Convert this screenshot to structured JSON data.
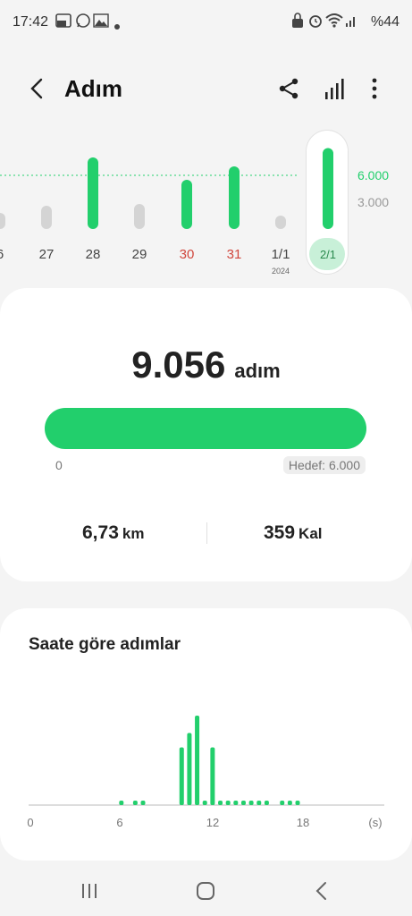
{
  "status_bar": {
    "time": "17:42",
    "battery": "%44",
    "icons": [
      "gallery-05-icon",
      "whatsapp-icon",
      "photo-icon",
      "dot-icon",
      "lock-icon",
      "alarm-icon",
      "wifi-icon",
      "signal-icon"
    ]
  },
  "header": {
    "title": "Adım",
    "icons": [
      "back-icon",
      "share-icon",
      "bar-chart-icon",
      "more-icon"
    ]
  },
  "daily_chart": {
    "days": [
      {
        "label": "6",
        "value": 1800,
        "color": "#d4d4d4",
        "weekend": false
      },
      {
        "label": "27",
        "value": 2600,
        "color": "#d4d4d4",
        "weekend": false
      },
      {
        "label": "28",
        "value": 8000,
        "color": "#22cf6c",
        "weekend": false
      },
      {
        "label": "29",
        "value": 2800,
        "color": "#d4d4d4",
        "weekend": false
      },
      {
        "label": "30",
        "value": 5500,
        "color": "#22cf6c",
        "weekend": true
      },
      {
        "label": "31",
        "value": 7000,
        "color": "#22cf6c",
        "weekend": true
      },
      {
        "label": "1/1",
        "sublabel": "2024",
        "value": 1500,
        "color": "#d4d4d4",
        "weekend": false
      },
      {
        "label": "2/1",
        "value": 9056,
        "color": "#22cf6c",
        "weekend": false,
        "selected": true
      }
    ],
    "goal_ticks": [
      {
        "label": "6.000",
        "value": 6000,
        "color": "#22cf6c"
      },
      {
        "label": "3.000",
        "value": 3000,
        "color": "#999999"
      }
    ]
  },
  "summary": {
    "steps": "9.056",
    "unit": "adım",
    "progress": 1.0,
    "min_label": "0",
    "goal_label": "Hedef: 6.000",
    "distance": "6,73",
    "distance_unit": "km",
    "calories": "359",
    "calories_unit": "Kal"
  },
  "hourly": {
    "title": "Saate göre adımlar",
    "x_ticks": [
      "0",
      "6",
      "12",
      "18",
      "(s)"
    ]
  },
  "chart_data": {
    "type": "bar",
    "title": "Saate göre adımlar",
    "xlabel": "(s)",
    "ylabel": "",
    "xlim": [
      0,
      21
    ],
    "x_ticks": [
      0,
      6,
      12,
      18
    ],
    "ylim": [
      0,
      1600
    ],
    "x": [
      6.0,
      6.9,
      7.4,
      9.9,
      10.4,
      10.9,
      11.4,
      11.9,
      12.4,
      12.9,
      13.4,
      13.9,
      14.4,
      14.9,
      15.4,
      16.4,
      16.9,
      17.4
    ],
    "values": [
      40,
      40,
      40,
      1000,
      1250,
      1550,
      40,
      1000,
      40,
      40,
      40,
      40,
      40,
      40,
      40,
      40,
      40,
      40
    ],
    "color": "#22cf6c"
  },
  "colors": {
    "accent": "#22cf6c",
    "weekend": "#d0463c",
    "inactive": "#d4d4d4"
  }
}
